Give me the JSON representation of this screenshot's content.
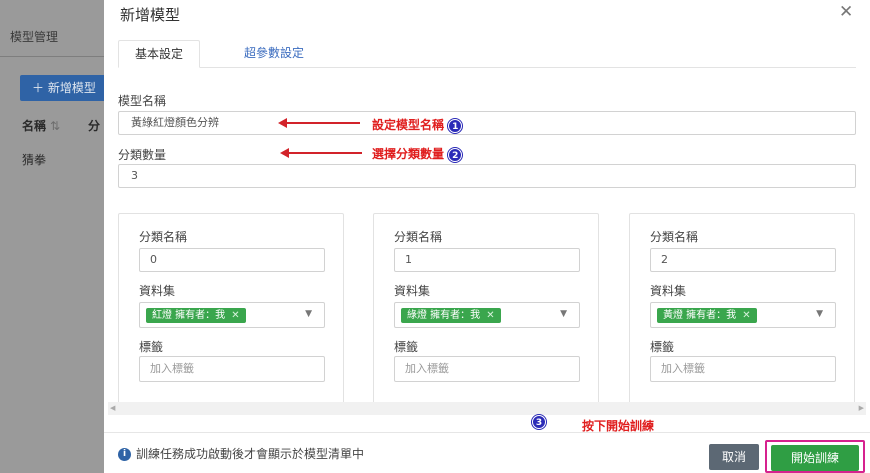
{
  "background": {
    "tab": "模型管理",
    "new_button": "＋ 新增模型",
    "col_name": "名稱",
    "col_name_sort": "⇅",
    "col_class": "分",
    "row1": "猜拳"
  },
  "modal": {
    "title": "新增模型",
    "close": "✕",
    "tabs": [
      "基本設定",
      "超參數設定"
    ],
    "model_name_label": "模型名稱",
    "model_name_value": "黃綠紅燈顏色分辨",
    "class_count_label": "分類數量",
    "class_count_value": "3",
    "annotations": {
      "a1": "設定模型名稱",
      "a1_num": "1",
      "a2": "選擇分類數量",
      "a2_num": "2",
      "a3": "按下開始訓練",
      "a3_num": "3"
    },
    "classes": [
      {
        "name_label": "分類名稱",
        "name": "0",
        "dataset_label": "資料集",
        "dataset_tag": "紅燈 擁有者：我",
        "tag_remove": "✕",
        "tags_label": "標籤",
        "tags_placeholder": "加入標籤"
      },
      {
        "name_label": "分類名稱",
        "name": "1",
        "dataset_label": "資料集",
        "dataset_tag": "綠燈 擁有者：我",
        "tag_remove": "✕",
        "tags_label": "標籤",
        "tags_placeholder": "加入標籤"
      },
      {
        "name_label": "分類名稱",
        "name": "2",
        "dataset_label": "資料集",
        "dataset_tag": "黃燈 擁有者：我",
        "tag_remove": "✕",
        "tags_label": "標籤",
        "tags_placeholder": "加入標籤"
      }
    ],
    "footer_info": "訓練任務成功啟動後才會顯示於模型清單中",
    "cancel": "取消",
    "start": "開始訓練"
  },
  "colors": {
    "primary": "#2f63a6",
    "tag_green": "#3aa64d",
    "start_green": "#2f9e44",
    "annotation_red": "#e01e1e",
    "highlight_magenta": "#d6218e"
  }
}
